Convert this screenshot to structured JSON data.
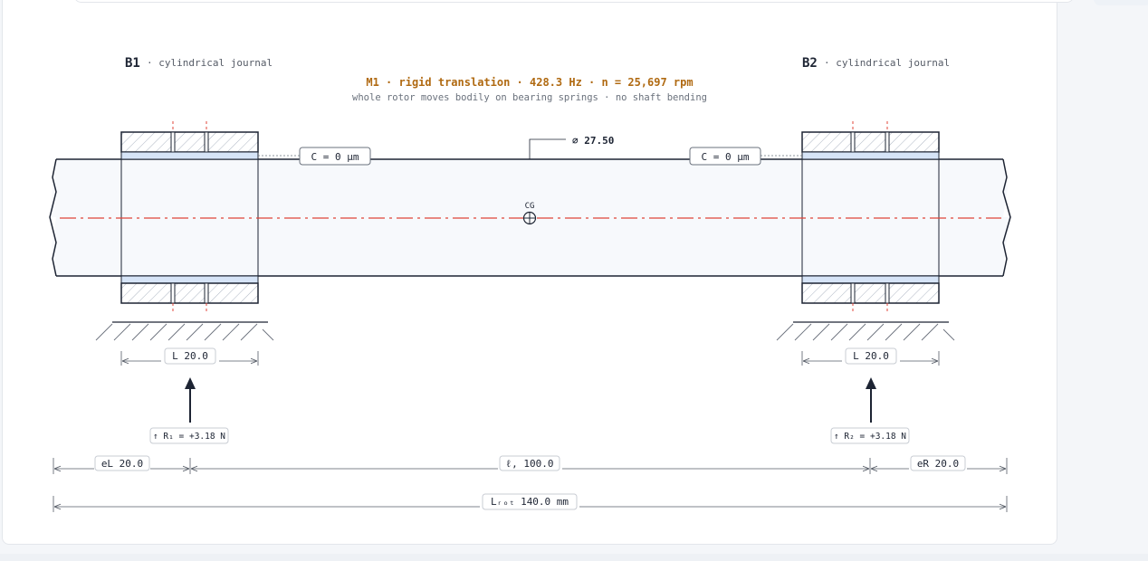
{
  "bearings": [
    {
      "id": "B1",
      "type": "· cylindrical journal",
      "clearance": "C = 0 μm",
      "length": "L 20.0",
      "reaction": "↑ R₁ = +3.18 N"
    },
    {
      "id": "B2",
      "type": "· cylindrical journal",
      "clearance": "C = 0 μm",
      "length": "L 20.0",
      "reaction": "↑ R₂ = +3.18 N"
    }
  ],
  "mode": {
    "title": "M1 · rigid translation · 428.3 Hz · n = 25,697 rpm",
    "subtitle": "whole rotor moves bodily on bearing springs · no shaft bending"
  },
  "shaft": {
    "diameter": "⌀ 27.50",
    "cg_label": "CG"
  },
  "dimensions": {
    "overhang_left": "eL 20.0",
    "span": "ℓ, 100.0",
    "overhang_right": "eR 20.0",
    "total": "Lᵣₒₜ 140.0 mm"
  },
  "colors": {
    "outline": "#1d2433",
    "shaft_fill": "#f7f9fc",
    "liner_fill": "#d6e4f7",
    "hatch": "#aeb6c3",
    "centerline": "#e0453a",
    "mode_title": "#b06a12",
    "dim_line": "#555b66"
  }
}
